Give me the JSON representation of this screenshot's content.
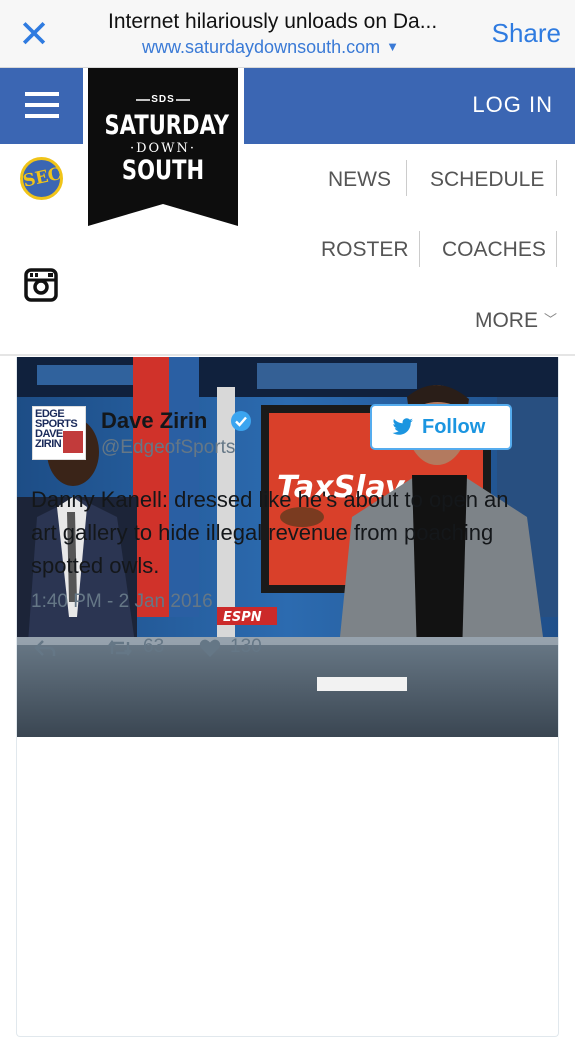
{
  "browser": {
    "title": "Internet hilariously unloads on Da...",
    "url": "www.saturdaydownsouth.com",
    "share_label": "Share",
    "close_icon": "close-icon"
  },
  "header": {
    "brand_color": "#3b66b3",
    "login_label": "LOG IN",
    "logo": {
      "small": "SDS",
      "line1": "SATURDAY",
      "line2": "DOWN",
      "line3": "SOUTH"
    },
    "sec_badge": "SEC"
  },
  "nav": {
    "items": [
      "NEWS",
      "SCHEDULE",
      "ROSTER",
      "COACHES"
    ],
    "more_label": "MORE"
  },
  "tweet": {
    "avatar_text": "EDGE SPORTS DAVE ZIRIN",
    "display_name": "Dave Zirin",
    "handle": "@EdgeofSports",
    "follow_label": "Follow",
    "text": "Danny Kanell: dressed like he's about to open an art gallery to hide illegal revenue from poaching spotted owls.",
    "timestamp": "1:40 PM - 2 Jan 2016",
    "retweets": "63",
    "likes": "130",
    "photo_caption_text": "TaxSlay"
  }
}
